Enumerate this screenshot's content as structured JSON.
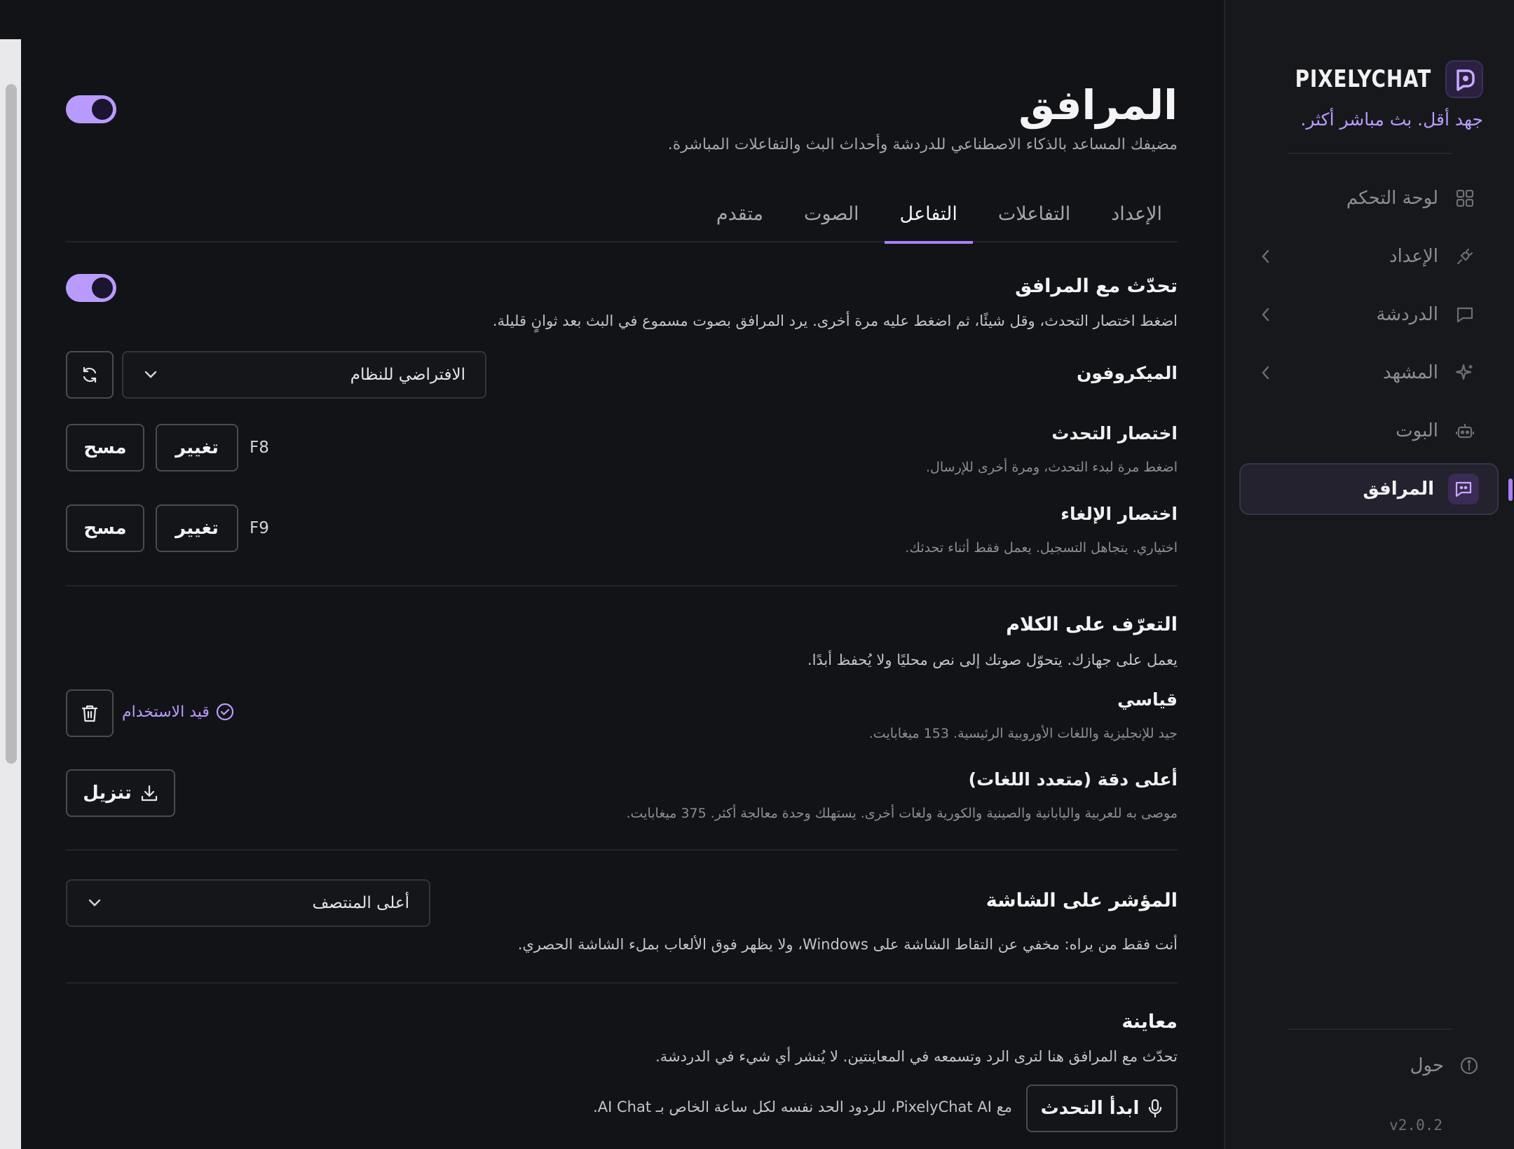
{
  "brand": {
    "name": "PIXELYCHAT",
    "tagline": "جهد أقل. بث مباشر أكثر."
  },
  "nav": {
    "items": [
      {
        "label": "لوحة التحكم",
        "icon": "grid-icon",
        "has_chevron": false,
        "active": false
      },
      {
        "label": "الإعداد",
        "icon": "plug-icon",
        "has_chevron": true,
        "active": false
      },
      {
        "label": "الدردشة",
        "icon": "chat-icon",
        "has_chevron": true,
        "active": false
      },
      {
        "label": "المشهد",
        "icon": "sparkle-icon",
        "has_chevron": true,
        "active": false
      },
      {
        "label": "البوت",
        "icon": "robot-icon",
        "has_chevron": false,
        "active": false
      },
      {
        "label": "المرافق",
        "icon": "companion-chat-icon",
        "has_chevron": false,
        "active": true
      }
    ],
    "about_label": "حول",
    "version": "v2.0.2"
  },
  "page": {
    "title": "المرافق",
    "subtitle": "مضيفك المساعد بالذكاء الاصطناعي للدردشة وأحداث البث والتفاعلات المباشرة.",
    "main_toggle_on": true
  },
  "tabs": [
    {
      "label": "الإعداد",
      "active": false
    },
    {
      "label": "التفاعلات",
      "active": false
    },
    {
      "label": "التفاعل",
      "active": true
    },
    {
      "label": "الصوت",
      "active": false
    },
    {
      "label": "متقدم",
      "active": false
    }
  ],
  "talk": {
    "title": "تحدّث مع المرافق",
    "description": "اضغط اختصار التحدث، وقل شيئًا، ثم اضغط عليه مرة أخرى. يرد المرافق بصوت مسموع في البث بعد ثوانٍ قليلة.",
    "toggle_on": true,
    "microphone_label": "الميكروفون",
    "microphone_value": "الافتراضي للنظام",
    "ptt_label": "اختصار التحدث",
    "ptt_hint": "اضغط مرة لبدء التحدث، ومرة أخرى للإرسال.",
    "ptt_key": "F8",
    "cancel_label": "اختصار الإلغاء",
    "cancel_hint": "اختياري. يتجاهل التسجيل. يعمل فقط أثناء تحدثك.",
    "cancel_key": "F9",
    "change_label": "تغيير",
    "clear_label": "مسح"
  },
  "speech": {
    "title": "التعرّف على الكلام",
    "description": "يعمل على جهازك. يتحوّل صوتك إلى نص محليًا ولا يُحفظ أبدًا.",
    "standard_label": "قياسي",
    "standard_hint": "جيد للإنجليزية واللغات الأوروبية الرئيسية. 153 ميغابايت.",
    "in_use_label": "قيد الاستخدام",
    "best_label": "أعلى دقة (متعدد اللغات)",
    "best_hint": "موصى به للعربية واليابانية والصينية والكورية ولغات أخرى. يستهلك وحدة معالجة أكثر. 375 ميغابايت.",
    "download_label": "تنزيل"
  },
  "indicator": {
    "title": "المؤشر على الشاشة",
    "description": "أنت فقط من يراه: مخفي عن التقاط الشاشة على Windows، ولا يظهر فوق الألعاب بملء الشاشة الحصري.",
    "position_value": "أعلى المنتصف"
  },
  "preview": {
    "title": "معاينة",
    "description": "تحدّث مع المرافق هنا لترى الرد وتسمعه في المعاينتين. لا يُنشر أي شيء في الدردشة.",
    "start_label": "ابدأ التحدث",
    "note": "مع PixelyChat AI، للردود الحد نفسه لكل ساعة الخاص بـ AI Chat."
  },
  "colors": {
    "accent": "#b99bff",
    "background": "#121316",
    "sidebar": "#17181b"
  }
}
